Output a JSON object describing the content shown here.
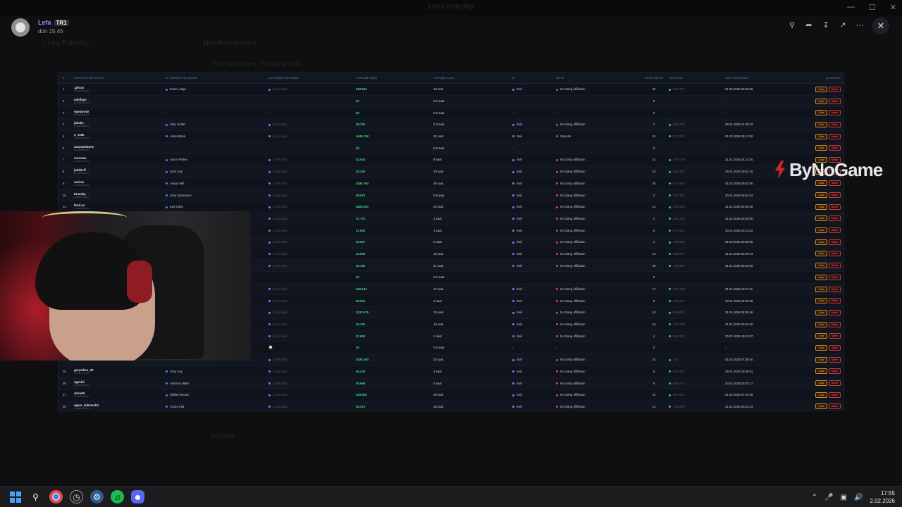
{
  "window": {
    "title": "Letra Roleplay"
  },
  "viewer": {
    "user": "Lefa",
    "tag": "TR1",
    "time": "dün 15:45"
  },
  "background": {
    "server": "Letra Roleplay",
    "channel": "bloodline-sunucu",
    "notice": "Yeni bildirimler: Bağlantı için...",
    "bottom_user": "lefaaaa"
  },
  "table": {
    "headers": [
      "#",
      "DISCORD BİLGİLERİ",
      "IC KARAKTER ADLARI",
      "ÇEVRİMİÇİ DURUMU",
      "TOPLAM PARA",
      "TOPLAM SAAT",
      "İŞ",
      "ÇETE",
      "GİRİŞ SAYISI",
      "TELEFON",
      "SON GÖRÜLME",
      "İŞLEMLER"
    ],
    "rows": [
      {
        "n": "1",
        "discord": ".gfrozy",
        "id": "1234567890123",
        "char": "Evan Lodge",
        "online": "Çevrimdışı",
        "money": "$18.863",
        "time": "13 saat",
        "job": "Sivil",
        "gang": "No Gang Affiliation",
        "count": "32",
        "phone": "5547277",
        "last": "01.02.2026 00:48:56"
      },
      {
        "n": "2",
        "discord": "adolfayo",
        "id": "1234567890123",
        "char": "-",
        "online": "-",
        "money": "$0",
        "time": "0.0 saat",
        "job": "-",
        "gang": "-",
        "count": "0",
        "phone": "-",
        "last": "-"
      },
      {
        "n": "3",
        "discord": "egemyos0",
        "id": "1234567890123",
        "char": "-",
        "online": "-",
        "money": "$0",
        "time": "0.0 saat",
        "job": "-",
        "gang": "-",
        "count": "0",
        "phone": "-",
        "last": "-"
      },
      {
        "n": "4",
        "discord": "jakobe_",
        "id": "1234567890123",
        "char": "Jake Hollar",
        "online": "Çevrimdışı",
        "money": "$8.700",
        "time": "0.3 saat",
        "job": "Sivil",
        "gang": "No Gang Affiliation",
        "count": "2",
        "phone": "6332243",
        "last": "29.01.2026 21:38:33"
      },
      {
        "n": "5",
        "discord": "0_xn80",
        "id": "1234567890123",
        "char": "Anbel Bank",
        "online": "Çevrimdışı",
        "money": "$449.768",
        "time": "32 saat",
        "job": "Sivil",
        "gang": "Çete 66",
        "count": "24",
        "phone": "9712303",
        "last": "01.02.2026 06:13:59"
      },
      {
        "n": "6",
        "discord": "assassin5474",
        "id": "1234567890123",
        "char": "-",
        "online": "-",
        "money": "$0",
        "time": "0.0 saat",
        "job": "-",
        "gang": "-",
        "count": "0",
        "phone": "-",
        "last": "-"
      },
      {
        "n": "7",
        "discord": "monviea",
        "id": "1234567890123",
        "char": "Aaron Parker",
        "online": "Çevrimdışı",
        "money": "$2.044",
        "time": "8 saat",
        "job": "Sivil",
        "gang": "No Gang Affiliation",
        "count": "41",
        "phone": "5786279",
        "last": "31.01.2026 04:14:35"
      },
      {
        "n": "8",
        "discord": "jakdlarff",
        "id": "1234567890123",
        "char": "Jack Low",
        "online": "Çevrimdışı",
        "money": "$3.339",
        "time": "10 saat",
        "job": "Sivil",
        "gang": "No Gang Affiliation",
        "count": "10",
        "phone": "6641257",
        "last": "29.01.2026 19:51:16"
      },
      {
        "n": "9",
        "discord": "amirva",
        "id": "1234567890123",
        "char": "Arwan Will",
        "online": "Çevrimdışı",
        "money": "$186.760",
        "time": "28 saat",
        "job": "Sivil",
        "gang": "No Gang Affiliation",
        "count": "25",
        "phone": "9127659",
        "last": "01.02.2026 09:52:56"
      },
      {
        "n": "10",
        "discord": "Erasday",
        "id": "1234567890123",
        "char": "John Dorrennon",
        "online": "Çevrimdışı",
        "money": "$8.970",
        "time": "0.5 saat",
        "job": "Sivil",
        "gang": "No Gang Affiliation",
        "count": "3",
        "phone": "5707853",
        "last": "30.01.2026 06:54:04"
      },
      {
        "n": "11",
        "discord": "fluid.xx",
        "id": "1234567890123",
        "char": "Zed Clark",
        "online": "Çevrimdışı",
        "money": "$828.830",
        "time": "23 saat",
        "job": "Sivil",
        "gang": "No Gang Affiliation",
        "count": "14",
        "phone": "9916986",
        "last": "31.01.2026 03:29:38"
      },
      {
        "n": "12",
        "discord": "",
        "id": "",
        "char": "",
        "online": "Çevrimdışı",
        "money": "$7.770",
        "time": "1 saat",
        "job": "Sivil",
        "gang": "No Gang Affiliation",
        "count": "4",
        "phone": "6601765",
        "last": "31.01.2026 03:52:00"
      },
      {
        "n": "13",
        "discord": "",
        "id": "",
        "char": "",
        "online": "Çevrimdışı",
        "money": "$7.600",
        "time": "1 saat",
        "job": "Sivil",
        "gang": "No Gang Affiliation",
        "count": "6",
        "phone": "5774923",
        "last": "30.01.2026 23:13:02"
      },
      {
        "n": "14",
        "discord": "",
        "id": "",
        "char": "",
        "online": "Çevrimdışı",
        "money": "$4.047",
        "time": "2 saat",
        "job": "Sivil",
        "gang": "No Gang Affiliation",
        "count": "4",
        "phone": "1856298",
        "last": "01.02.2026 00:50:35"
      },
      {
        "n": "15",
        "discord": "",
        "id": "",
        "char": "",
        "online": "Çevrimdışı",
        "money": "$4.065",
        "time": "18 saat",
        "job": "Sivil",
        "gang": "No Gang Affiliation",
        "count": "12",
        "phone": "8903977",
        "last": "31.01.2026 02:29:43"
      },
      {
        "n": "16",
        "discord": "",
        "id": "",
        "char": "",
        "online": "Çevrimdışı",
        "money": "$2.106",
        "time": "21 saat",
        "job": "Sivil",
        "gang": "No Gang Affiliation",
        "count": "26",
        "phone": "1101398",
        "last": "31.01.2026 03:26:02"
      },
      {
        "n": "17",
        "discord": "",
        "id": "",
        "char": "",
        "online": "-",
        "money": "$0",
        "time": "0.0 saat",
        "job": "-",
        "gang": "-",
        "count": "0",
        "phone": "-",
        "last": "-"
      },
      {
        "n": "18",
        "discord": "",
        "id": "",
        "char": "",
        "online": "Çevrimdışı",
        "money": "$38.163",
        "time": "17 saat",
        "job": "Sivil",
        "gang": "No Gang Affiliation",
        "count": "17",
        "phone": "3917463",
        "last": "31.01.2026 18:47:11"
      },
      {
        "n": "19",
        "discord": "",
        "id": "",
        "char": "",
        "online": "Çevrimdışı",
        "money": "$6.500",
        "time": "2 saat",
        "job": "Sivil",
        "gang": "No Gang Affiliation",
        "count": "8",
        "phone": "5363327",
        "last": "29.01.2026 22:36:36"
      },
      {
        "n": "20",
        "discord": "",
        "id": "",
        "char": "",
        "online": "Çevrimdışı",
        "money": "$133.975",
        "time": "13 saat",
        "job": "Sivil",
        "gang": "No Gang Affiliation",
        "count": "10",
        "phone": "6498653",
        "last": "31.01.2026 04:50:46"
      },
      {
        "n": "21",
        "discord": "",
        "id": "",
        "char": "",
        "online": "Çevrimdışı",
        "money": "$6.330",
        "time": "10 saat",
        "job": "Sivil",
        "gang": "No Gang Affiliation",
        "count": "16",
        "phone": "1271368",
        "last": "31.01.2026 02:54:40"
      },
      {
        "n": "22",
        "discord": "",
        "id": "",
        "char": "",
        "online": "Çevrimdışı",
        "money": "$7.600",
        "time": "1 saat",
        "job": "Sivil",
        "gang": "No Gang Affiliation",
        "count": "4",
        "phone": "6682853",
        "last": "30.01.2026 19:42:57"
      },
      {
        "n": "23",
        "discord": "",
        "id": "",
        "char": "",
        "online": "-",
        "money": "$0",
        "time": "0.0 saat",
        "job": "-",
        "gang": "-",
        "count": "0",
        "phone": "-",
        "last": "-"
      },
      {
        "n": "24",
        "discord": "",
        "id": "",
        "char": "",
        "online": "Çevrimdışı",
        "money": "$435.280",
        "time": "23 saat",
        "job": "Sivil",
        "gang": "No Gang Affiliation",
        "count": "24",
        "phone": "222",
        "last": "01.02.2026 07:36:40"
      },
      {
        "n": "25",
        "discord": "gerymkcu_06",
        "id": "1234567890123",
        "char": "Tony Guy",
        "online": "Çevrimdışı",
        "money": "$6.400",
        "time": "2 saat",
        "job": "Sivil",
        "gang": "No Gang Affiliation",
        "count": "5",
        "phone": "5816547",
        "last": "29.01.2026 23:08:51"
      },
      {
        "n": "26",
        "discord": "egechii",
        "id": "1234567890123",
        "char": "Anthony Miller",
        "online": "Çevrimdışı",
        "money": "$9.666",
        "time": "5 saat",
        "job": "Sivil",
        "gang": "No Gang Affiliation",
        "count": "5",
        "phone": "6960472",
        "last": "30.01.2026 03:42:17"
      },
      {
        "n": "27",
        "discord": "ahmeth",
        "id": "1234567890123",
        "char": "William Brown",
        "online": "Çevrimdışı",
        "money": "$29.663",
        "time": "30 saat",
        "job": "Sivil",
        "gang": "No Gang Affiliation",
        "count": "24",
        "phone": "5976981",
        "last": "01.02.2026 07:22:05"
      },
      {
        "n": "28",
        "discord": "egear_kahmesh0",
        "id": "1234567890123",
        "char": "Crane Kiat",
        "online": "Çevrimdışı",
        "money": "$5.470",
        "time": "16 saat",
        "job": "Sivil",
        "gang": "No Gang Affiliation",
        "count": "14",
        "phone": "7103809",
        "last": "31.01.2026 03:23:43"
      }
    ],
    "action_remove": "Çıkar",
    "action_delete": "Senle"
  },
  "watermark": "ByNoGame",
  "taskbar": {
    "time": "17:55",
    "date": "2.02.2026"
  },
  "colors": {
    "money": "#3ddc84",
    "accent": "#b57bff",
    "danger": "#e04444",
    "warning": "#d48a2a"
  }
}
